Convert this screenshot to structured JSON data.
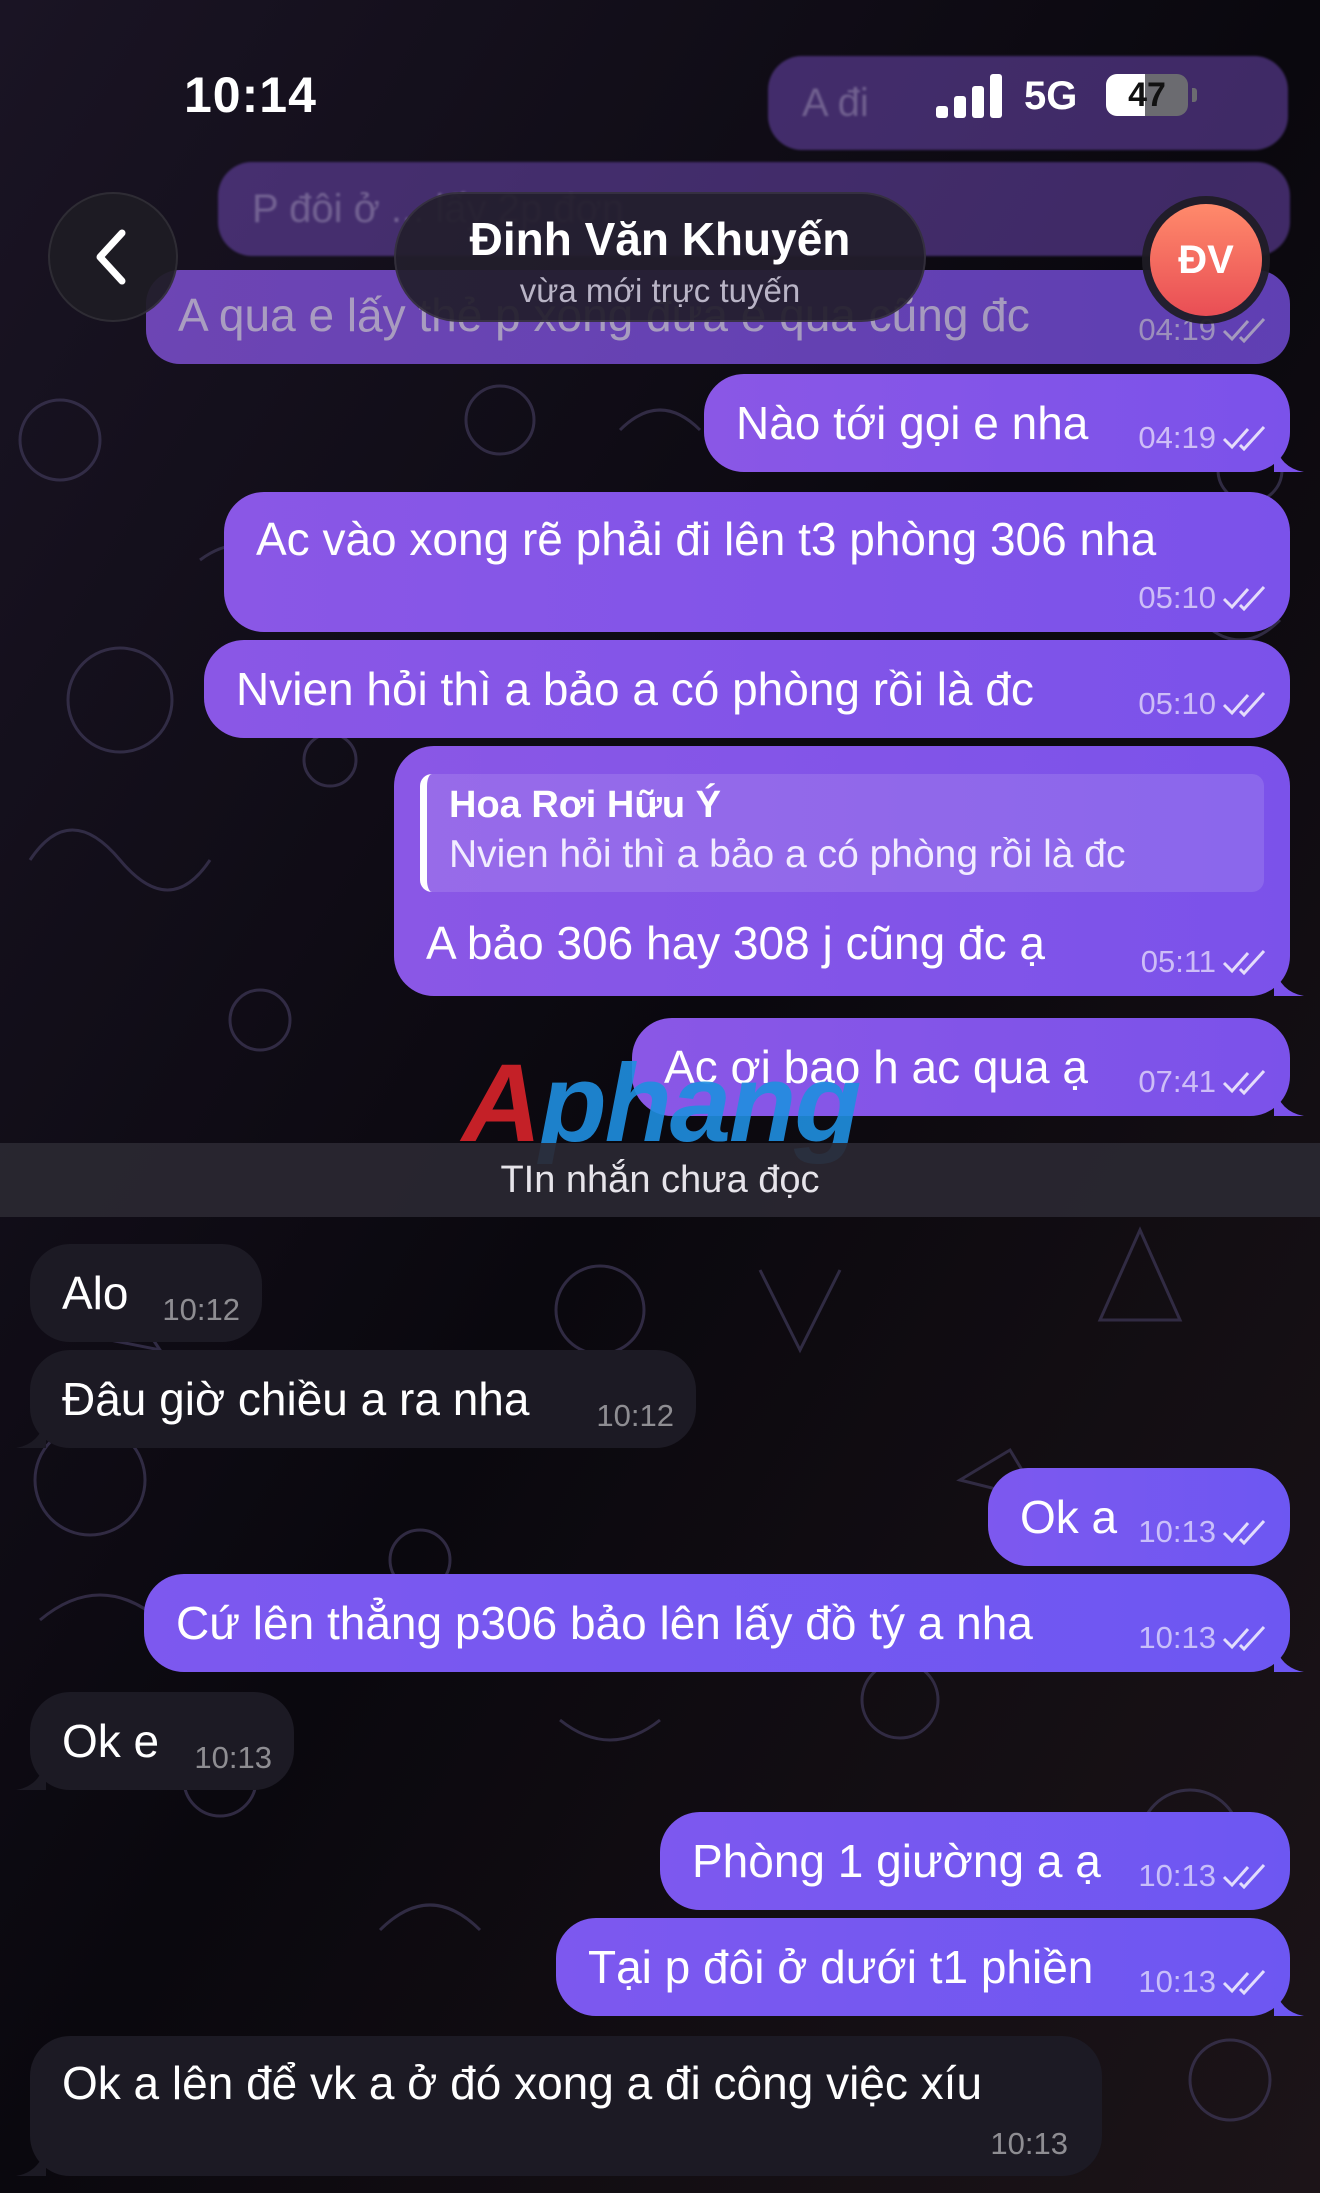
{
  "status_bar": {
    "time": "10:14",
    "network": "5G",
    "battery": "47",
    "battery_level": 0.47
  },
  "header": {
    "contact_name": "Đinh Văn Khuyến",
    "status": "vừa mới trực tuyến",
    "avatar_initials": "ĐV"
  },
  "faded_messages": [
    {
      "text": "A đi"
    },
    {
      "text": "P đôi ở ... lấy 2p đơn"
    }
  ],
  "messages": [
    {
      "dir": "out",
      "text": "A qua e lấy thẻ p xong đưa e qua cũng đc",
      "time": "04:19"
    },
    {
      "dir": "out",
      "text": "Nào tới gọi e nha",
      "time": "04:19"
    },
    {
      "dir": "out",
      "text": "Ac vào xong rẽ phải đi lên t3 phòng 306 nha",
      "time": "05:10"
    },
    {
      "dir": "out",
      "text": "Nvien hỏi thì a bảo a có phòng rồi là đc",
      "time": "05:10"
    },
    {
      "dir": "out",
      "reply_author": "Hoa Rơi Hữu Ý",
      "reply_text": "Nvien hỏi thì a bảo a có phòng rồi là đc",
      "text": "A bảo 306 hay 308 j cũng đc ạ",
      "time": "05:11"
    },
    {
      "dir": "out",
      "text": "Ac ơi bao h ac qua ạ",
      "time": "07:41"
    },
    {
      "dir": "in",
      "text": "Alo",
      "time": "10:12"
    },
    {
      "dir": "in",
      "text": "Đâu giờ chiều a ra nha",
      "time": "10:12"
    },
    {
      "dir": "out",
      "text": "Ok a",
      "time": "10:13"
    },
    {
      "dir": "out",
      "text": "Cứ lên thẳng p306 bảo lên lấy đồ tý a nha",
      "time": "10:13"
    },
    {
      "dir": "in",
      "text": "Ok e",
      "time": "10:13"
    },
    {
      "dir": "out",
      "text": "Phòng 1 giường a ạ",
      "time": "10:13"
    },
    {
      "dir": "out",
      "text": "Tại p đôi ở dưới t1 phiền",
      "time": "10:13"
    },
    {
      "dir": "in",
      "text": "Ok a lên để vk a ở đó xong a đi công việc xíu",
      "time": "10:13"
    }
  ],
  "unread_label": "TIn nhắn chưa đọc",
  "watermark": {
    "first": "A",
    "rest": "phang"
  },
  "colors": {
    "outgoing": "#8a57e6",
    "incoming": "#1c1a24",
    "avatar": "#f06a5e"
  },
  "icons": [
    "back-arrow-icon",
    "double-check-icon",
    "signal-icon",
    "battery-icon"
  ]
}
